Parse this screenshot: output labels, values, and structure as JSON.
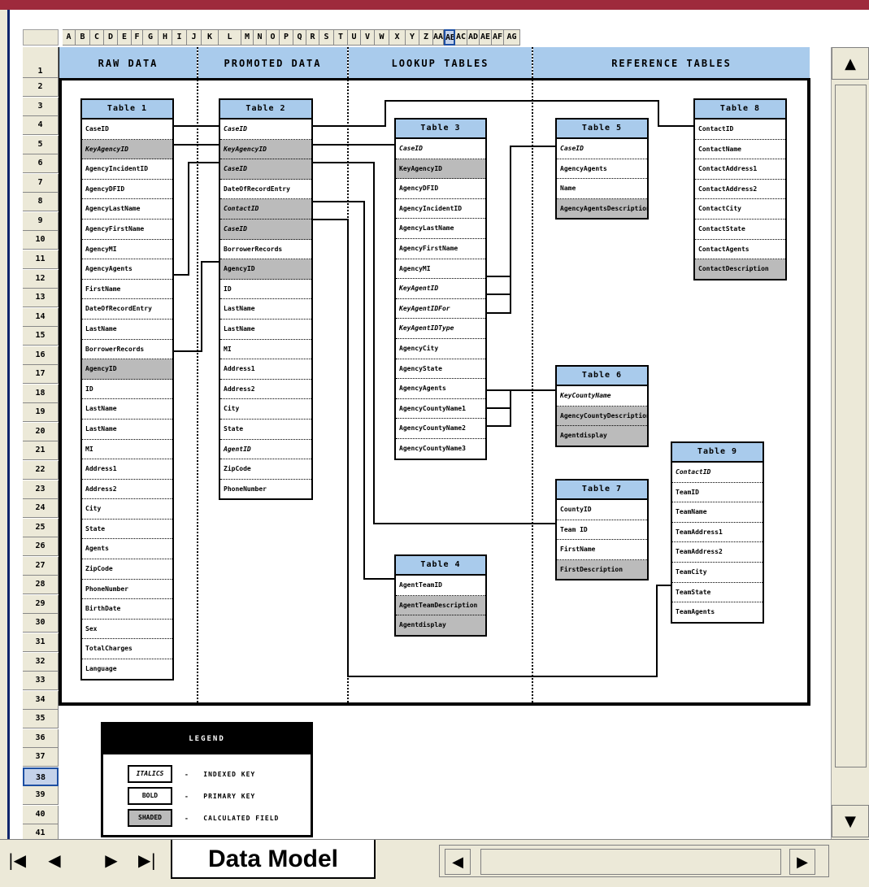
{
  "sheet": {
    "tab_label": "Data Model",
    "columns": [
      "A",
      "B",
      "C",
      "D",
      "E",
      "F",
      "G",
      "H",
      "I",
      "J",
      "K",
      "L",
      "M",
      "N",
      "O",
      "P",
      "Q",
      "R",
      "S",
      "T",
      "U",
      "V",
      "W",
      "X",
      "Y",
      "Z",
      "AA",
      "AB",
      "AC",
      "AD",
      "AE",
      "AF",
      "AG"
    ],
    "selected_column": "AB",
    "rows": [
      "1",
      "2",
      "3",
      "4",
      "5",
      "6",
      "7",
      "8",
      "9",
      "10",
      "11",
      "12",
      "13",
      "14",
      "15",
      "16",
      "17",
      "18",
      "19",
      "20",
      "21",
      "22",
      "23",
      "24",
      "25",
      "26",
      "27",
      "28",
      "29",
      "30",
      "31",
      "32",
      "33",
      "34",
      "35",
      "36",
      "37",
      "38",
      "39",
      "40",
      "41"
    ],
    "selected_row": "38"
  },
  "bands": {
    "raw": "RAW DATA",
    "promoted": "PROMOTED DATA",
    "lookup": "LOOKUP TABLES",
    "reference": "REFERENCE TABLES"
  },
  "tables": {
    "t1": {
      "title": "Table 1",
      "rows": [
        {
          "t": "CaseID",
          "k": false
        },
        {
          "t": "KeyAgencyID",
          "k": true,
          "i": true
        },
        {
          "t": "AgencyIncidentID",
          "k": false
        },
        {
          "t": "AgencyDFID",
          "k": false
        },
        {
          "t": "AgencyLastName",
          "k": false
        },
        {
          "t": "AgencyFirstName",
          "k": false
        },
        {
          "t": "AgencyMI",
          "k": false
        },
        {
          "t": "AgencyAgents",
          "k": false
        },
        {
          "t": "FirstName",
          "k": false
        },
        {
          "t": "DateOfRecordEntry",
          "k": false
        },
        {
          "t": "LastName",
          "k": false
        },
        {
          "t": "BorrowerRecords",
          "k": false
        },
        {
          "t": "AgencyID",
          "k": true
        },
        {
          "t": "ID",
          "k": false
        },
        {
          "t": "LastName",
          "k": false
        },
        {
          "t": "LastName",
          "k": false
        },
        {
          "t": "MI",
          "k": false
        },
        {
          "t": "Address1",
          "k": false
        },
        {
          "t": "Address2",
          "k": false
        },
        {
          "t": "City",
          "k": false
        },
        {
          "t": "State",
          "k": false
        },
        {
          "t": "Agents",
          "k": false
        },
        {
          "t": "ZipCode",
          "k": false
        },
        {
          "t": "PhoneNumber",
          "k": false
        },
        {
          "t": "BirthDate",
          "k": false
        },
        {
          "t": "Sex",
          "k": false
        },
        {
          "t": "TotalCharges",
          "k": false
        },
        {
          "t": "Language",
          "k": false
        }
      ]
    },
    "t2": {
      "title": "Table 2",
      "rows": [
        {
          "t": "CaseID",
          "k": false,
          "i": true
        },
        {
          "t": "KeyAgencyID",
          "k": true,
          "i": true
        },
        {
          "t": "CaseID",
          "k": true,
          "i": true
        },
        {
          "t": "DateOfRecordEntry",
          "k": false
        },
        {
          "t": "ContactID",
          "k": true,
          "i": true
        },
        {
          "t": "CaseID",
          "k": true,
          "i": true
        },
        {
          "t": "BorrowerRecords",
          "k": false
        },
        {
          "t": "AgencyID",
          "k": true
        },
        {
          "t": "ID",
          "k": false
        },
        {
          "t": "LastName",
          "k": false
        },
        {
          "t": "LastName",
          "k": false
        },
        {
          "t": "MI",
          "k": false
        },
        {
          "t": "Address1",
          "k": false
        },
        {
          "t": "Address2",
          "k": false
        },
        {
          "t": "City",
          "k": false
        },
        {
          "t": "State",
          "k": false
        },
        {
          "t": "AgentID",
          "k": false,
          "i": true
        },
        {
          "t": "ZipCode",
          "k": false
        },
        {
          "t": "PhoneNumber",
          "k": false
        }
      ]
    },
    "t3": {
      "title": "Table 3",
      "rows": [
        {
          "t": "CaseID",
          "k": false,
          "i": true
        },
        {
          "t": "KeyAgencyID",
          "k": true
        },
        {
          "t": "AgencyDFID",
          "k": false
        },
        {
          "t": "AgencyIncidentID",
          "k": false
        },
        {
          "t": "AgencyLastName",
          "k": false
        },
        {
          "t": "AgencyFirstName",
          "k": false
        },
        {
          "t": "AgencyMI",
          "k": false
        },
        {
          "t": "KeyAgentID",
          "k": false,
          "i": true
        },
        {
          "t": "KeyAgentIDFor",
          "k": false,
          "i": true
        },
        {
          "t": "KeyAgentIDType",
          "k": false,
          "i": true
        },
        {
          "t": "AgencyCity",
          "k": false
        },
        {
          "t": "AgencyState",
          "k": false
        },
        {
          "t": "AgencyAgents",
          "k": false
        },
        {
          "t": "AgencyCountyName1",
          "k": false
        },
        {
          "t": "AgencyCountyName2",
          "k": false
        },
        {
          "t": "AgencyCountyName3",
          "k": false
        }
      ]
    },
    "t4": {
      "title": "Table 4",
      "rows": [
        {
          "t": "AgentTeamID",
          "k": false
        },
        {
          "t": "AgentTeamDescription",
          "k": true
        },
        {
          "t": "Agentdisplay",
          "k": true
        }
      ]
    },
    "t5": {
      "title": "Table 5",
      "rows": [
        {
          "t": "CaseID",
          "k": false,
          "i": true
        },
        {
          "t": "AgencyAgents",
          "k": false
        },
        {
          "t": "Name",
          "k": false
        },
        {
          "t": "AgencyAgentsDescription",
          "k": true
        }
      ]
    },
    "t6": {
      "title": "Table 6",
      "rows": [
        {
          "t": "KeyCountyName",
          "k": false,
          "i": true
        },
        {
          "t": "AgencyCountyDescription",
          "k": true
        },
        {
          "t": "Agentdisplay",
          "k": true
        }
      ]
    },
    "t7": {
      "title": "Table 7",
      "rows": [
        {
          "t": "CountyID",
          "k": false
        },
        {
          "t": "Team ID",
          "k": false
        },
        {
          "t": "FirstName",
          "k": false
        },
        {
          "t": "FirstDescription",
          "k": true
        }
      ]
    },
    "t8": {
      "title": "Table 8",
      "rows": [
        {
          "t": "ContactID",
          "k": false
        },
        {
          "t": "ContactName",
          "k": false
        },
        {
          "t": "ContactAddress1",
          "k": false
        },
        {
          "t": "ContactAddress2",
          "k": false
        },
        {
          "t": "ContactCity",
          "k": false
        },
        {
          "t": "ContactState",
          "k": false
        },
        {
          "t": "ContactAgents",
          "k": false
        },
        {
          "t": "ContactDescription",
          "k": true
        }
      ]
    },
    "t9": {
      "title": "Table 9",
      "rows": [
        {
          "t": "ContactID",
          "k": false,
          "i": true
        },
        {
          "t": "TeamID",
          "k": false
        },
        {
          "t": "TeamName",
          "k": false
        },
        {
          "t": "TeamAddress1",
          "k": false
        },
        {
          "t": "TeamAddress2",
          "k": false
        },
        {
          "t": "TeamCity",
          "k": false
        },
        {
          "t": "TeamState",
          "k": false
        },
        {
          "t": "TeamAgents",
          "k": false
        }
      ]
    }
  },
  "legend": {
    "title": "LEGEND",
    "items": [
      {
        "swatch": "ITALICS",
        "label": "INDEXED KEY"
      },
      {
        "swatch": "BOLD",
        "label": "PRIMARY KEY"
      },
      {
        "swatch": "SHADED",
        "label": "CALCULATED FIELD"
      }
    ]
  },
  "colors": {
    "title_bar": "#9e2a3c",
    "header_blue": "#a9cbec",
    "key_gray": "#bbbbbb",
    "selection": "#1d4fa2"
  },
  "icons": {
    "up": "triangle-up",
    "down": "triangle-down",
    "first": "first-sheet",
    "prev": "prev-sheet",
    "next": "next-sheet",
    "last": "last-sheet",
    "left": "scroll-left",
    "right": "scroll-right"
  }
}
